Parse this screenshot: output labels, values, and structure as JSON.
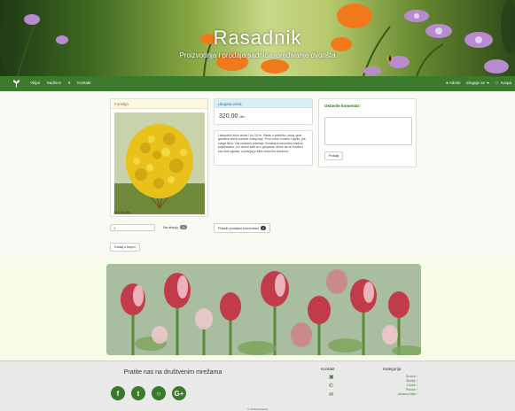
{
  "header": {
    "title": "Rasadnik",
    "subtitle": "Proizvodnja i prodaja sadnica, uređivanje dvorišta"
  },
  "nav": {
    "items": [
      "Vkijal",
      "Sadnice",
      "▾",
      "Kontakt"
    ],
    "right": [
      "Admin",
      "Izloguje se",
      "Korpa"
    ]
  },
  "product": {
    "name": "Forsitija",
    "price": "320.00 din."
  },
  "total": {
    "label": "Ukupna cena",
    "value": "320.00",
    "unit": "din."
  },
  "description": "Listopadni žbun visine i do 3,5 m. Raste u prečniku, srnaj, gore grančice sitnih cvetova žutog boje. Prvo cvetu u martu i aprilu, pre svega lišća. Voli sunčane položaje, ili manjem senovima sadi se pojedinačno, a u većim sadi se u grupama. Može da se formira i kao živa ograda, u pravljaj je bližu vrsta tim drvetima.",
  "comment": {
    "title": "Ostavite komentar:",
    "submit": "Pošalji"
  },
  "quantity": {
    "value": "1",
    "stock_label": "Na stanju",
    "stock_count": "20"
  },
  "actions": {
    "show_comments": "Prikaži prodajne komentare",
    "show_comments_count": "0",
    "add_to_cart": "Dodaj u korpu"
  },
  "footer": {
    "follow": "Pratite nas na društvenim mrežama",
    "contact": "Kontakt",
    "categories": "Kategorija",
    "category_items": [
      "Drveće ›",
      "Žbunje ›",
      "Cveće ›",
      "Povrće ›",
      "Ukrasno bilje ›"
    ],
    "copyright": "© 2019 Rasadnik"
  },
  "colors": {
    "nav": "#3a7a2a",
    "footer": "#e9e9e9",
    "accent": "#2d6a1f"
  }
}
